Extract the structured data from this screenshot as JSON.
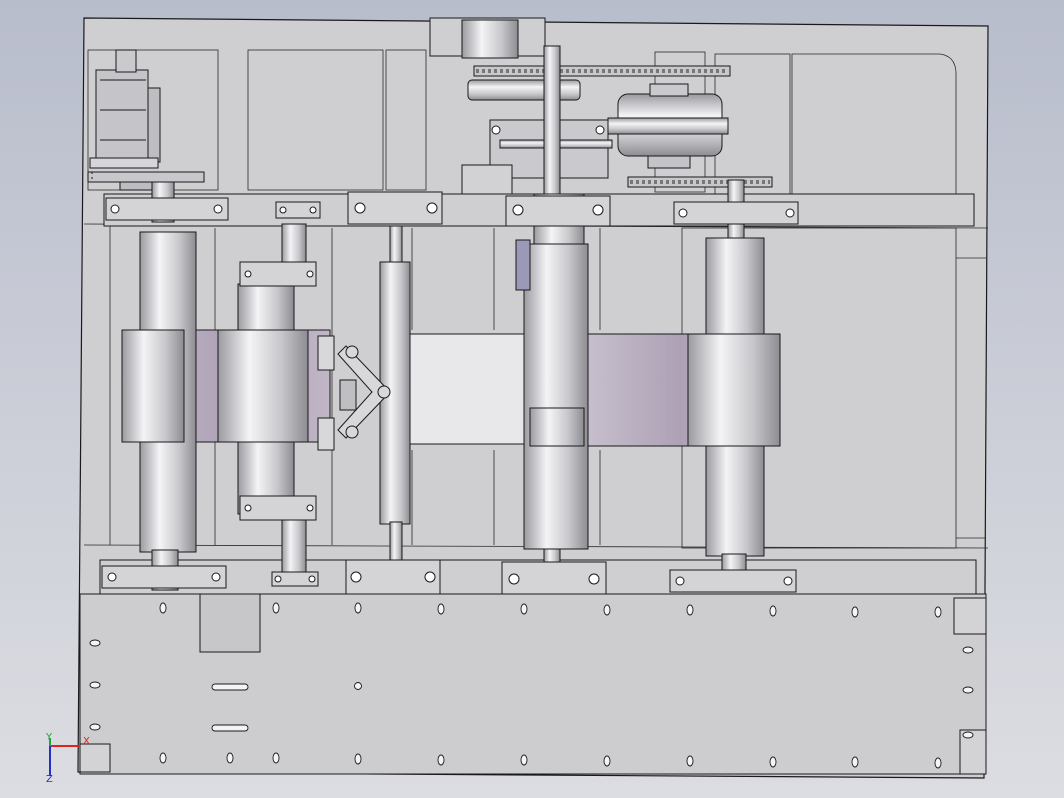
{
  "view": {
    "background_top": "#b8bdcc",
    "background_bottom": "#dcdde2",
    "part_fill": "#cfcfd1",
    "edge_color": "#1a1a1a",
    "belt_color": "#b3a7ba"
  },
  "triad": {
    "x_label": "X",
    "y_label": "Y",
    "z_label": "Z",
    "x_color": "#e0241b",
    "y_color": "#1fa33a",
    "z_color": "#2530c8"
  }
}
